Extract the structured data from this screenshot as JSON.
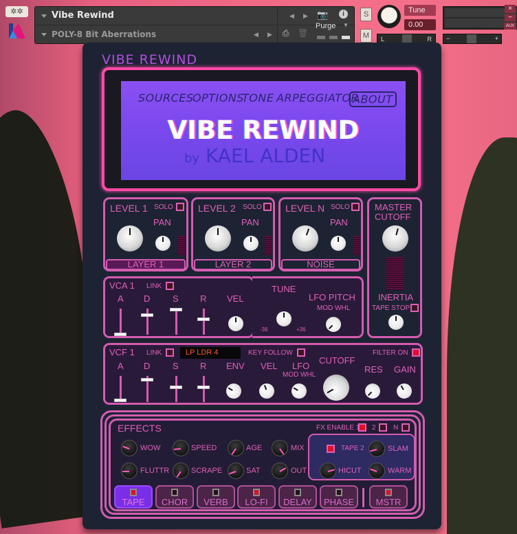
{
  "header": {
    "instrument_title": "Vibe Rewind",
    "preset_name": "POLY-8 Bit Aberrations",
    "purge_label": "Purge",
    "solo_label": "S",
    "mute_label": "M",
    "tune_label": "Tune",
    "tune_value": "0.00",
    "pan_left": "L",
    "pan_right": "R",
    "vol_minus": "−",
    "vol_plus": "+",
    "close_label": "×",
    "minimize_label": "−",
    "aux_label": "AUX"
  },
  "brand_title": "VIBE REWIND",
  "screen": {
    "nav": [
      "SOURCES",
      "OPTIONS",
      "TONE",
      "ARPEGGIATOR",
      "ABOUT"
    ],
    "active_nav": "ABOUT",
    "hero_title": "VIBE REWIND",
    "by": "by",
    "author": "KAEL ALDEN"
  },
  "layers": [
    {
      "level_label": "LEVEL 1",
      "solo_label": "SOLO",
      "pan_label": "PAN",
      "name": "LAYER 1",
      "selected": true
    },
    {
      "level_label": "LEVEL 2",
      "solo_label": "SOLO",
      "pan_label": "PAN",
      "name": "LAYER 2",
      "selected": false
    },
    {
      "level_label": "LEVEL N",
      "solo_label": "SOLO",
      "pan_label": "PAN",
      "name": "NOISE",
      "selected": false
    }
  ],
  "master": {
    "cutoff_label": "MASTER",
    "cutoff_label2": "CUTOFF",
    "inertia_label": "INERTIA",
    "tape_stop_label": "TAPE STOP"
  },
  "vca": {
    "title": "VCA 1",
    "link_label": "LINK",
    "adsr": [
      "A",
      "D",
      "S",
      "R"
    ],
    "vel_label": "VEL",
    "tune_label": "TUNE",
    "tune_min": "-36",
    "tune_max": "+36",
    "lfo_pitch_label": "LFO PITCH",
    "mod_whl_label": "MOD WHL"
  },
  "vcf": {
    "title": "VCF 1",
    "link_label": "LINK",
    "filter_type": "LP LDR 4",
    "key_follow_label": "KEY FOLLOW",
    "filter_on_label": "FILTER ON",
    "adsr": [
      "A",
      "D",
      "S",
      "R"
    ],
    "env_label": "ENV",
    "vel_label": "VEL",
    "lfo_label": "LFO",
    "mod_whl_label": "MOD WHL",
    "cutoff_label": "CUTOFF",
    "res_label": "RES",
    "gain_label": "GAIN"
  },
  "effects": {
    "title": "EFFECTS",
    "fx_enable_label": "FX ENABLE 1",
    "fx2_label": "2",
    "fxn_label": "N",
    "knobs_row1": [
      "WOW",
      "SPEED",
      "AGE",
      "MIX"
    ],
    "knobs_row2": [
      "FLUTTR",
      "SCRAPE",
      "SAT",
      "OUT"
    ],
    "tape2_label": "TAPE 2",
    "slam_label": "SLAM",
    "hicut_label": "HICUT",
    "warm_label": "WARM",
    "tabs": [
      {
        "label": "TAPE",
        "on": true,
        "active": true
      },
      {
        "label": "CHOR",
        "on": false
      },
      {
        "label": "VERB",
        "on": false
      },
      {
        "label": "LO-FI",
        "on": true
      },
      {
        "label": "DELAY",
        "on": false
      },
      {
        "label": "PHASE",
        "on": false
      },
      {
        "label": "MSTR",
        "on": true
      }
    ]
  },
  "colors": {
    "accent_pink": "#e060b8",
    "screen_purple": "#7a48ee",
    "led_red": "#e0102a",
    "panel_bg": "#1d2333"
  }
}
